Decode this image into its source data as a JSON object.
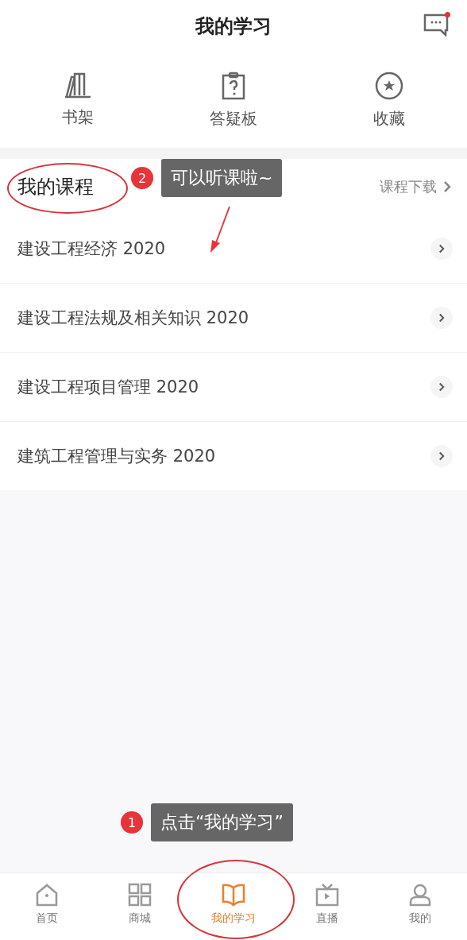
{
  "header": {
    "title": "我的学习",
    "has_unread": true
  },
  "shortcuts": [
    {
      "label": "书架",
      "kind": "bookshelf"
    },
    {
      "label": "答疑板",
      "kind": "question"
    },
    {
      "label": "收藏",
      "kind": "star"
    }
  ],
  "courses": {
    "title": "我的课程",
    "download_link": "课程下载",
    "items": [
      {
        "title": "建设工程经济 2020"
      },
      {
        "title": "建设工程法规及相关知识 2020"
      },
      {
        "title": "建设工程项目管理 2020"
      },
      {
        "title": "建筑工程管理与实务 2020"
      }
    ]
  },
  "tab_bar": [
    {
      "label": "首页",
      "kind": "home",
      "selected": false
    },
    {
      "label": "商城",
      "kind": "grid",
      "selected": false
    },
    {
      "label": "我的学习",
      "kind": "book",
      "selected": true
    },
    {
      "label": "直播",
      "kind": "tv",
      "selected": false
    },
    {
      "label": "我的",
      "kind": "person",
      "selected": false
    }
  ],
  "annotations": [
    {
      "number": "2",
      "text": "可以听课啦~"
    },
    {
      "number": "1",
      "text": "点击“我的学习”"
    }
  ]
}
